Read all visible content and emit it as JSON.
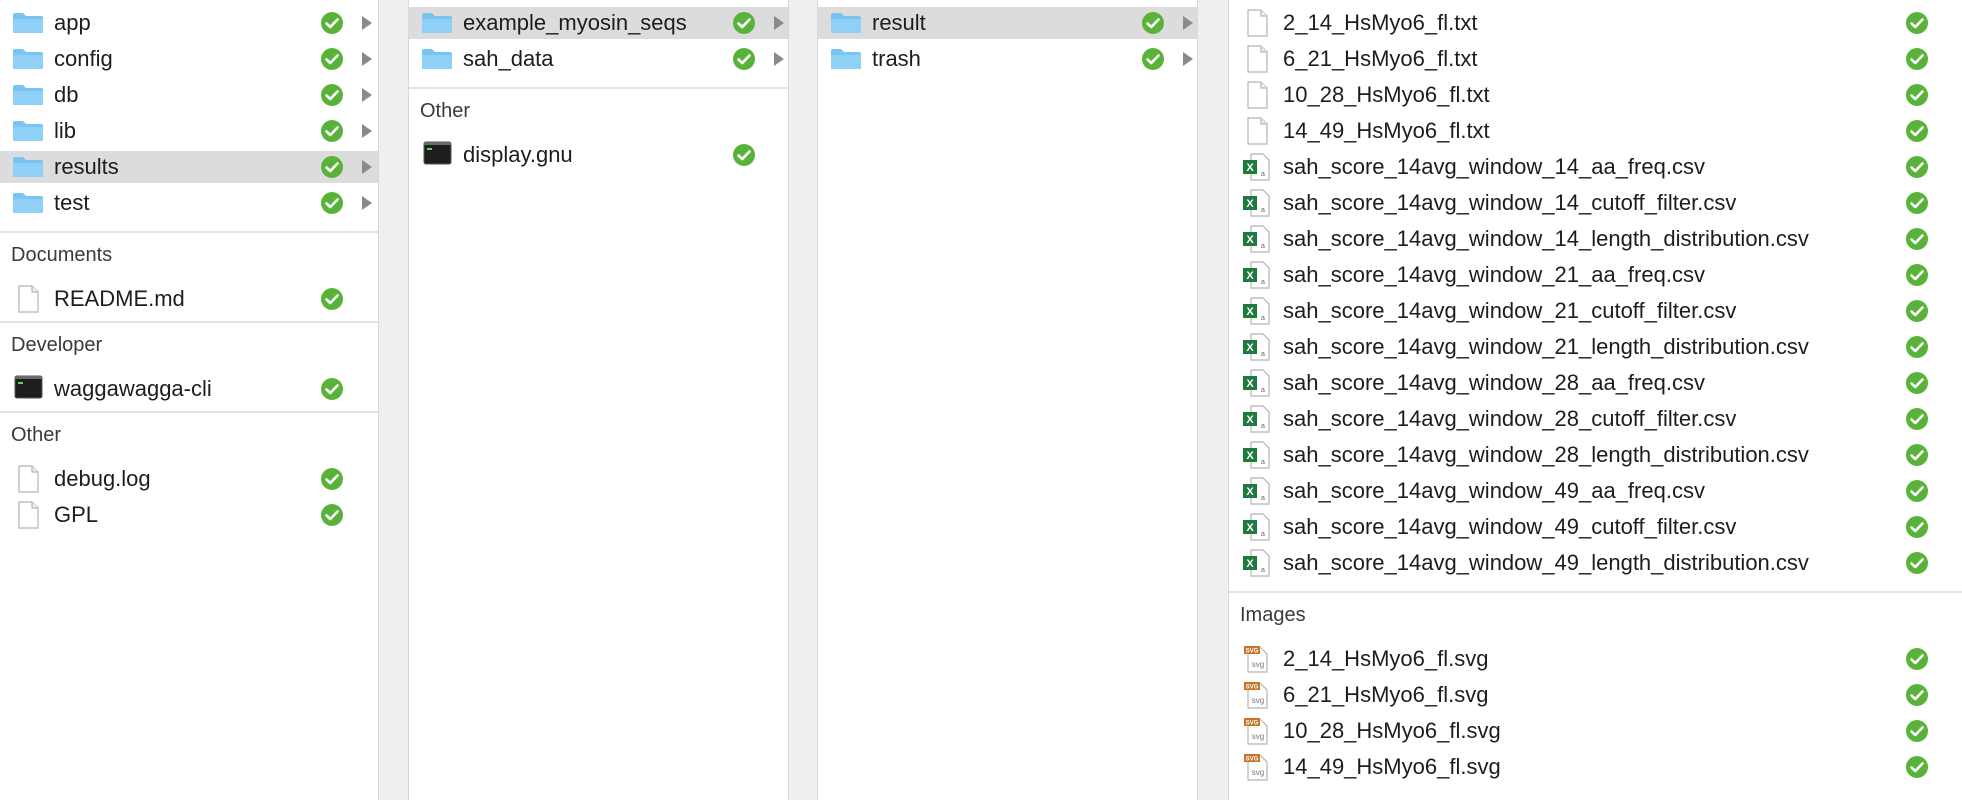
{
  "colors": {
    "accent_check": "#59b33a",
    "folder": "#7ec8f5",
    "selection": "#dcdcdc"
  },
  "icons": {
    "folder": "folder-icon",
    "file": "document-icon",
    "terminal": "terminal-icon",
    "excel": "excel-file-icon",
    "svg": "svg-file-icon",
    "check": "synced-check-icon",
    "arrow": "disclosure-arrow-icon"
  },
  "column1": {
    "folders": [
      {
        "label": "app"
      },
      {
        "label": "config"
      },
      {
        "label": "db"
      },
      {
        "label": "lib"
      },
      {
        "label": "results",
        "selected": true
      },
      {
        "label": "test"
      }
    ],
    "documents_header": "Documents",
    "documents": [
      {
        "label": "README.md"
      }
    ],
    "developer_header": "Developer",
    "developer": [
      {
        "label": "waggawagga-cli"
      }
    ],
    "other_header": "Other",
    "other": [
      {
        "label": "debug.log"
      },
      {
        "label": "GPL"
      }
    ]
  },
  "column2": {
    "folders": [
      {
        "label": "example_myosin_seqs",
        "selected": true
      },
      {
        "label": "sah_data"
      }
    ],
    "other_header": "Other",
    "other": [
      {
        "label": "display.gnu"
      }
    ]
  },
  "column3": {
    "folders": [
      {
        "label": "result",
        "selected": true
      },
      {
        "label": "trash"
      }
    ]
  },
  "column4": {
    "text_files": [
      {
        "label": "2_14_HsMyo6_fl.txt"
      },
      {
        "label": "6_21_HsMyo6_fl.txt"
      },
      {
        "label": "10_28_HsMyo6_fl.txt"
      },
      {
        "label": "14_49_HsMyo6_fl.txt"
      }
    ],
    "csv_files": [
      {
        "label": "sah_score_14avg_window_14_aa_freq.csv"
      },
      {
        "label": "sah_score_14avg_window_14_cutoff_filter.csv"
      },
      {
        "label": "sah_score_14avg_window_14_length_distribution.csv"
      },
      {
        "label": "sah_score_14avg_window_21_aa_freq.csv"
      },
      {
        "label": "sah_score_14avg_window_21_cutoff_filter.csv"
      },
      {
        "label": "sah_score_14avg_window_21_length_distribution.csv"
      },
      {
        "label": "sah_score_14avg_window_28_aa_freq.csv"
      },
      {
        "label": "sah_score_14avg_window_28_cutoff_filter.csv"
      },
      {
        "label": "sah_score_14avg_window_28_length_distribution.csv"
      },
      {
        "label": "sah_score_14avg_window_49_aa_freq.csv"
      },
      {
        "label": "sah_score_14avg_window_49_cutoff_filter.csv"
      },
      {
        "label": "sah_score_14avg_window_49_length_distribution.csv"
      }
    ],
    "images_header": "Images",
    "images": [
      {
        "label": "2_14_HsMyo6_fl.svg"
      },
      {
        "label": "6_21_HsMyo6_fl.svg"
      },
      {
        "label": "10_28_HsMyo6_fl.svg"
      },
      {
        "label": "14_49_HsMyo6_fl.svg"
      }
    ]
  }
}
